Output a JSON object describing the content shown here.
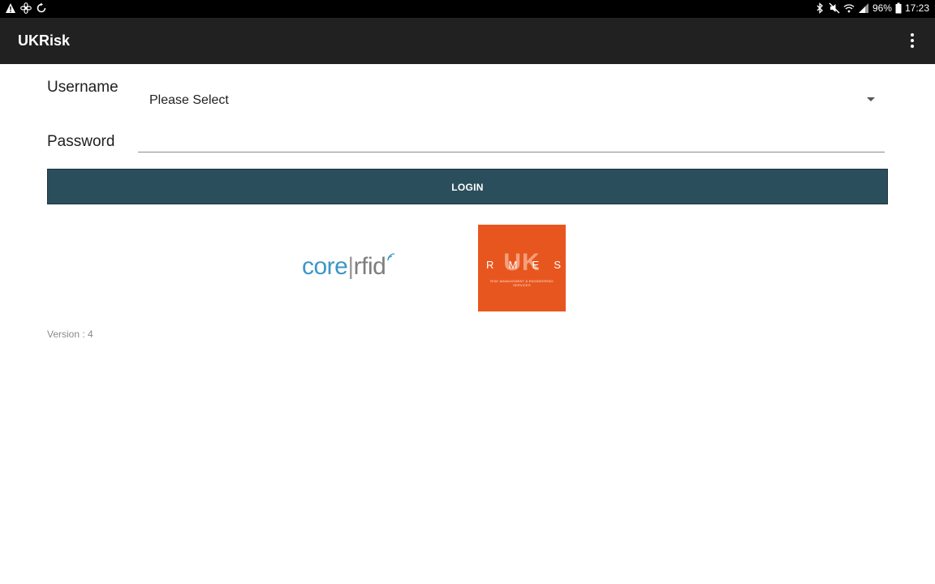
{
  "status_bar": {
    "left_icons": [
      "warning-icon",
      "fan-icon",
      "sync-icon"
    ],
    "right_icons": [
      "bluetooth-icon",
      "mute-icon",
      "wifi-icon",
      "signal-icon",
      "battery-icon"
    ],
    "battery": "96%",
    "time": "17:23"
  },
  "app_bar": {
    "title": "UKRisk",
    "menu_icon": "more-vert-icon"
  },
  "form": {
    "username_label": "Username",
    "username_selected": "Please Select",
    "password_label": "Password",
    "password_value": "",
    "login_label": "LOGIN"
  },
  "logos": {
    "corerfid": {
      "core": "core",
      "sep": "|",
      "rfid": "rfid"
    },
    "rmes": {
      "uk": "UK",
      "letters": [
        "R",
        "M",
        "E",
        "S"
      ],
      "subtitle": "RISK MANAGEMENT & ENGINEERING SERVICES"
    }
  },
  "version": "Version : 4",
  "colors": {
    "app_bar": "#212121",
    "login_button": "#2a4e5c",
    "rmes_orange": "#e8561f",
    "corerfid_blue": "#3d96c7"
  }
}
